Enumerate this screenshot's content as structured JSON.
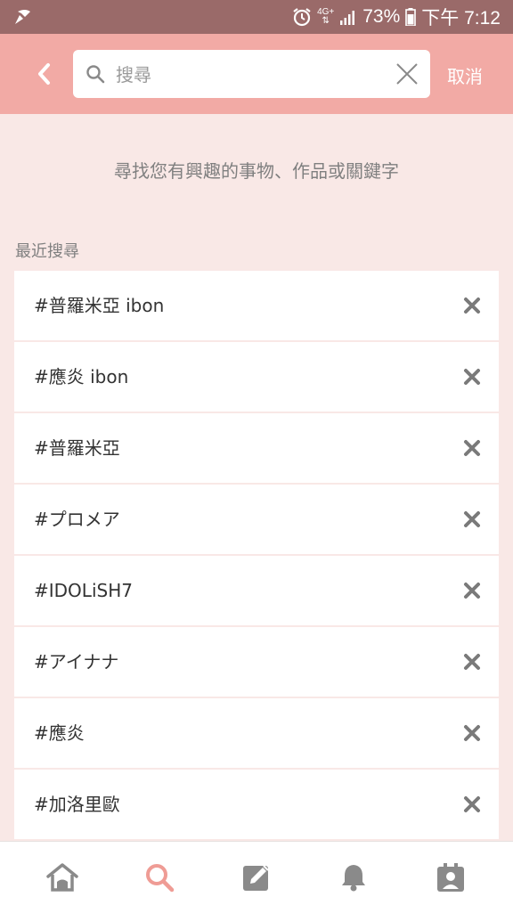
{
  "status_bar": {
    "network": "4G+",
    "battery": "73%",
    "time": "下午 7:12"
  },
  "header": {
    "back_icon": "chevron-left-icon",
    "search_placeholder": "搜尋",
    "search_value": "",
    "cancel_label": "取消"
  },
  "hint": "尋找您有興趣的事物、作品或關鍵字",
  "recent": {
    "title": "最近搜尋",
    "items": [
      {
        "label": "#普羅米亞 ibon"
      },
      {
        "label": "#應炎 ibon"
      },
      {
        "label": "#普羅米亞"
      },
      {
        "label": "#プロメア"
      },
      {
        "label": "#IDOLiSH7"
      },
      {
        "label": "#アイナナ"
      },
      {
        "label": "#應炎"
      },
      {
        "label": "#加洛里歐"
      }
    ]
  },
  "bottom_nav": {
    "items": [
      {
        "icon": "home-icon",
        "active": false
      },
      {
        "icon": "search-icon",
        "active": true
      },
      {
        "icon": "edit-icon",
        "active": false
      },
      {
        "icon": "bell-icon",
        "active": false
      },
      {
        "icon": "profile-icon",
        "active": false
      }
    ]
  },
  "colors": {
    "header": "#f2aaa5",
    "background": "#f9e8e6",
    "status_bar": "#9a6a69",
    "accent": "#ef9c95",
    "nav_icon": "#8a8a8a"
  }
}
